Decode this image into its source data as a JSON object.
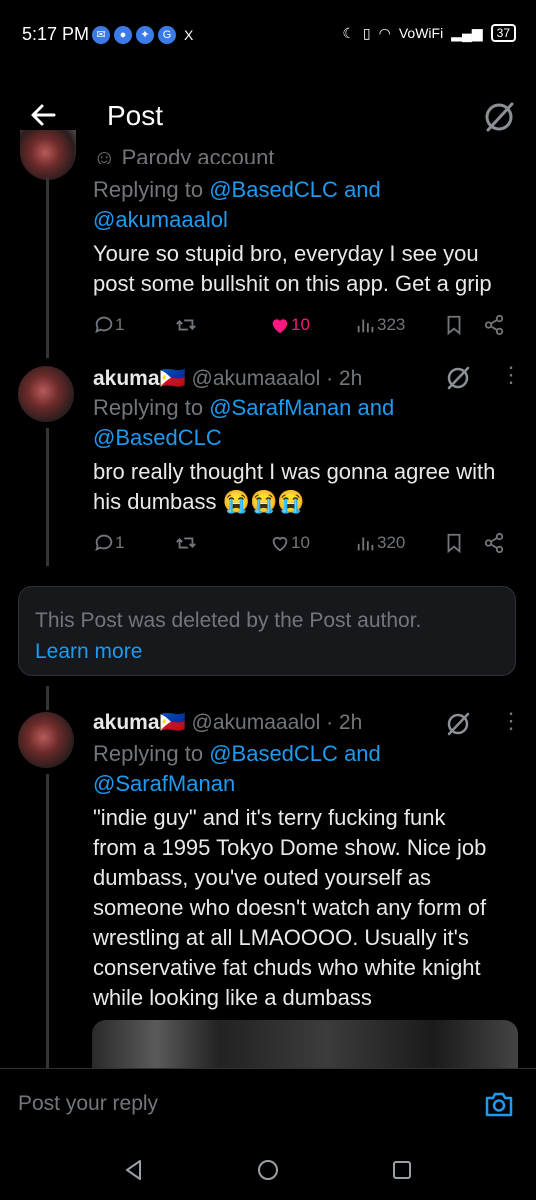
{
  "status_bar": {
    "time": "5:17 PM",
    "app_icons": [
      "messenger-icon",
      "chat-icon",
      "app-icon",
      "google-icon"
    ],
    "x_label": "X",
    "network": "VoWiFi",
    "battery": "37"
  },
  "header": {
    "title": "Post"
  },
  "post1": {
    "partial_label": "Parody account",
    "replying_prefix": "Replying to",
    "replying_user1": "@BasedCLC",
    "replying_and": "and",
    "replying_user2": "@akumaaalol",
    "text_line1": "Youre so stupid bro, everyday I see you",
    "text_line2": "post some bullshit on this app. Get a grip",
    "replies": "1",
    "likes": "10",
    "views": "323",
    "like_color": "#f91880"
  },
  "post2": {
    "name": "akuma",
    "flag": "🇵🇭",
    "handle_time": "@akumaaalol · 2h",
    "replying_prefix": "Replying to",
    "replying_user1": "@SarafManan",
    "replying_and": "and",
    "replying_user2": "@BasedCLC",
    "text_line1": "bro really thought I was gonna agree with",
    "text_line2": "his dumbass",
    "emojis": "😭😭😭",
    "replies": "1",
    "likes": "10",
    "views": "320"
  },
  "deleted": {
    "message": "This Post was deleted by the Post author.",
    "link": "Learn more"
  },
  "post3": {
    "name": "akuma",
    "flag": "🇵🇭",
    "handle_time": "@akumaaalol · 2h",
    "replying_prefix": "Replying to",
    "replying_user1": "@BasedCLC",
    "replying_and": "and",
    "replying_user2": "@SarafManan",
    "lines": [
      "\"indie guy\" and it's terry fucking funk",
      "from a 1995 Tokyo Dome show. Nice job",
      "dumbass, you've outed yourself as",
      "someone who doesn't watch any form of",
      "wrestling at all LMAOOOO. Usually it's",
      "conservative fat chuds who white knight",
      "while looking like a dumbass"
    ]
  },
  "reply_bar": {
    "placeholder": "Post your reply"
  },
  "colors": {
    "accent": "#1d9bf0",
    "muted": "#71767b",
    "background": "#000000"
  }
}
